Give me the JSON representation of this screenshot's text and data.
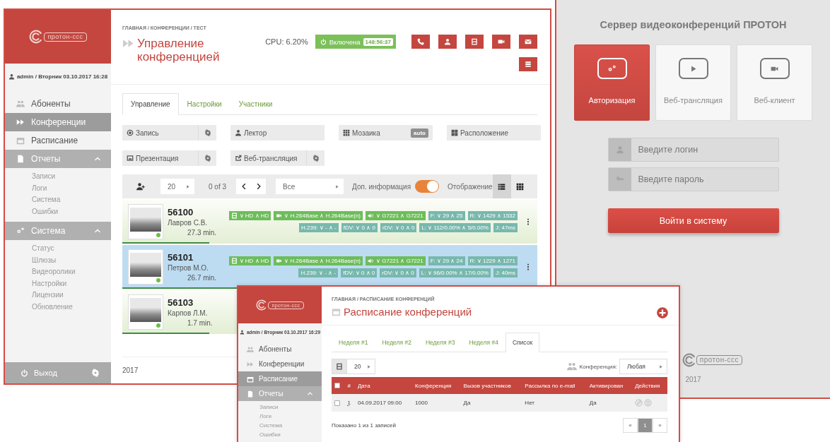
{
  "conference_window": {
    "sidebar": {
      "logo": "протон-ссс",
      "user_info": "admin / Вторник 03.10.2017 16:28",
      "nav": [
        {
          "label": "Абоненты",
          "selected": false
        },
        {
          "label": "Конференции",
          "selected": true
        },
        {
          "label": "Расписание",
          "selected": false
        },
        {
          "label": "Отчеты",
          "selected": false,
          "expanded": true,
          "children": [
            {
              "label": "Записи"
            },
            {
              "label": "Логи"
            },
            {
              "label": "Система"
            },
            {
              "label": "Ошибки"
            }
          ]
        },
        {
          "label": "Система",
          "selected": false,
          "expanded": true,
          "children": [
            {
              "label": "Статус"
            },
            {
              "label": "Шлюзы"
            },
            {
              "label": "Видеоролики"
            },
            {
              "label": "Настройки"
            },
            {
              "label": "Лицензии"
            },
            {
              "label": "Обновление"
            }
          ]
        }
      ],
      "logout": "Выход"
    },
    "breadcrumb": "ГЛАВНАЯ / КОНФЕРЕНЦИИ / ТЕСТ",
    "title": "Управление конференцией",
    "cpu": "CPU: 6.20%",
    "status": {
      "label": "Включена",
      "timer": "148:56:37",
      "on": true
    },
    "tabs": [
      {
        "label": "Управление",
        "selected": true
      },
      {
        "label": "Настройки",
        "selected": false
      },
      {
        "label": "Участники",
        "selected": false
      }
    ],
    "controls": [
      {
        "label": "Запись",
        "settings": true
      },
      {
        "label": "Лектор",
        "settings": false
      },
      {
        "label": "Мозаика",
        "settings": false,
        "badge": "auto"
      },
      {
        "label": "Расположение",
        "settings": false
      },
      {
        "label": "Презентация",
        "settings": true
      },
      {
        "label": "Веб-трансляция",
        "settings": true
      }
    ],
    "toolbar": {
      "page_size": "20",
      "range": "0 of 3",
      "filter": "Все",
      "extra_info": {
        "label": "Доп. информация",
        "on": true
      },
      "view_label": "Отображение",
      "views": [
        {
          "selected": true
        },
        {
          "selected": false
        }
      ]
    },
    "participants": [
      {
        "number": "56100",
        "name": "Лавров С.В.",
        "duration": "27.3 min.",
        "selected": false,
        "online": true,
        "level": 0.21,
        "badges": [
          [
            {
              "kind": "film",
              "text": "∨ HD ∧ HD",
              "color": "#6dbd5b"
            },
            {
              "kind": "camera",
              "text": "∨ H.264Base ∧ H.264Base(n)",
              "color": "#6dbd5b"
            },
            {
              "kind": "sound",
              "text": "∨ G7221 ∧ G7221",
              "color": "#6dbd5b"
            },
            {
              "kind": "text",
              "text": "F: ∨ 29 ∧ 25",
              "color": "#78b8ad"
            },
            {
              "kind": "text",
              "text": "R: ∨ 1429 ∧ 1532",
              "color": "#78b8ad"
            }
          ],
          [
            {
              "kind": "text",
              "text": "H.239: ∨ - ∧ -",
              "color": "#78b8ad"
            },
            {
              "kind": "text",
              "text": "fDV: ∨ 0 ∧ 0",
              "color": "#78b8ad"
            },
            {
              "kind": "text",
              "text": "rDV: ∨ 0 ∧ 0",
              "color": "#78b8ad"
            },
            {
              "kind": "text",
              "text": "L: ∨ 112/0.00% ∧ 5/0.00%",
              "color": "#78b8ad"
            },
            {
              "kind": "text",
              "text": "J: 47ms",
              "color": "#78b8ad"
            }
          ]
        ]
      },
      {
        "number": "56101",
        "name": "Петров М.О.",
        "duration": "26.7 min.",
        "selected": true,
        "online": true,
        "level": 1,
        "badges": [
          [
            {
              "kind": "film",
              "text": "∨ HD ∧ HD",
              "color": "#6dbd5b"
            },
            {
              "kind": "camera",
              "text": "∨ H.264Base ∧ H.264Base(n)",
              "color": "#6dbd5b"
            },
            {
              "kind": "sound",
              "text": "∨ G7221 ∧ G7221",
              "color": "#6dbd5b"
            },
            {
              "kind": "text",
              "text": "F: ∨ 29 ∧ 24",
              "color": "#78b8ad"
            },
            {
              "kind": "text",
              "text": "R: ∨ 1229 ∧ 1271",
              "color": "#78b8ad"
            }
          ],
          [
            {
              "kind": "text",
              "text": "H.239: ∨ - ∧ -",
              "color": "#78b8ad"
            },
            {
              "kind": "text",
              "text": "fDV: ∨ 0 ∧ 0",
              "color": "#78b8ad"
            },
            {
              "kind": "text",
              "text": "rDV: ∨ 0 ∧ 0",
              "color": "#78b8ad"
            },
            {
              "kind": "text",
              "text": "L: ∨ 96/0.00% ∧ 17/0.00%",
              "color": "#78b8ad"
            },
            {
              "kind": "text",
              "text": "J: 40ms",
              "color": "#78b8ad"
            }
          ]
        ]
      },
      {
        "number": "56103",
        "name": "Карпов Л.М.",
        "duration": "1.7 min.",
        "selected": false,
        "online": true,
        "level": 0.21
      }
    ],
    "footer": "2017"
  },
  "login_window": {
    "title": "Сервер видеоконференций ПРОТОН",
    "tiles": [
      {
        "label": "Авторизация",
        "selected": true
      },
      {
        "label": "Веб-трансляция",
        "selected": false
      },
      {
        "label": "Веб-клиент",
        "selected": false
      }
    ],
    "login": {
      "placeholder": "Введите логин"
    },
    "password": {
      "placeholder": "Введите пароль"
    },
    "submit": "Войти в систему",
    "logo": "протон-ссс",
    "year": "2017"
  },
  "schedule_window": {
    "sidebar": {
      "logo": "протон-ссс",
      "user_info": "admin / Вторник 03.10.2017 16:29",
      "nav": [
        {
          "label": "Абоненты",
          "selected": false
        },
        {
          "label": "Конференции",
          "selected": false
        },
        {
          "label": "Расписание",
          "selected": true
        },
        {
          "label": "Отчеты",
          "selected": false,
          "expanded": true,
          "children": [
            {
              "label": "Записи"
            },
            {
              "label": "Логи"
            },
            {
              "label": "Система"
            },
            {
              "label": "Ошибки"
            }
          ]
        }
      ]
    },
    "breadcrumb": "ГЛАВНАЯ / РАСПИСАНИЕ КОНФЕРЕНЦИЙ",
    "title": "Расписание конференций",
    "tabs": [
      {
        "label": "Неделя #1",
        "selected": false
      },
      {
        "label": "Неделя #2",
        "selected": false
      },
      {
        "label": "Неделя #3",
        "selected": false
      },
      {
        "label": "Неделя #4",
        "selected": false
      },
      {
        "label": "Список",
        "selected": true
      }
    ],
    "page_size": "20",
    "filter_label": "Конференция:",
    "filter_value": "Любая",
    "table": {
      "all_checked": false,
      "columns": [
        "#",
        "Дата",
        "Конференция",
        "Вызов участников",
        "Рассылка по e-mail",
        "Активирован",
        "Действия"
      ],
      "rows": [
        {
          "checked": false,
          "cells": [
            "1",
            "04.09.2017 09:00",
            "1000",
            "Да",
            "Нет",
            "Да"
          ]
        }
      ]
    },
    "summary": "Показано 1 из 1 записей",
    "pagination": {
      "prev": "«",
      "pages": [
        {
          "label": "1",
          "selected": true
        }
      ],
      "next": "»"
    }
  }
}
